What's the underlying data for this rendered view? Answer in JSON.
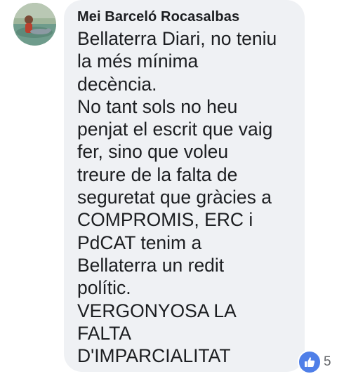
{
  "comment": {
    "author": "Mei Barceló Rocasalbas",
    "text_lines": [
      "Bellaterra Diari, no teniu",
      "la més mínima",
      "decència.",
      "No tant sols no heu",
      "penjat el escrit que vaig",
      "fer, sino que voleu",
      "treure de la falta de",
      "seguretat que gràcies a",
      "COMPROMIS, ERC i",
      "PdCAT tenim a",
      "Bellaterra un redit",
      "polític.",
      "VERGONYOSA LA",
      "FALTA",
      "D'IMPARCIALITAT"
    ],
    "reactions": {
      "icon": "like-thumbs-up-icon",
      "count": "5"
    }
  },
  "colors": {
    "bubble_background": "#eff1f4",
    "text": "#1c1e21",
    "like_blue": "#4f7fe8",
    "count_grey": "#65676b"
  }
}
